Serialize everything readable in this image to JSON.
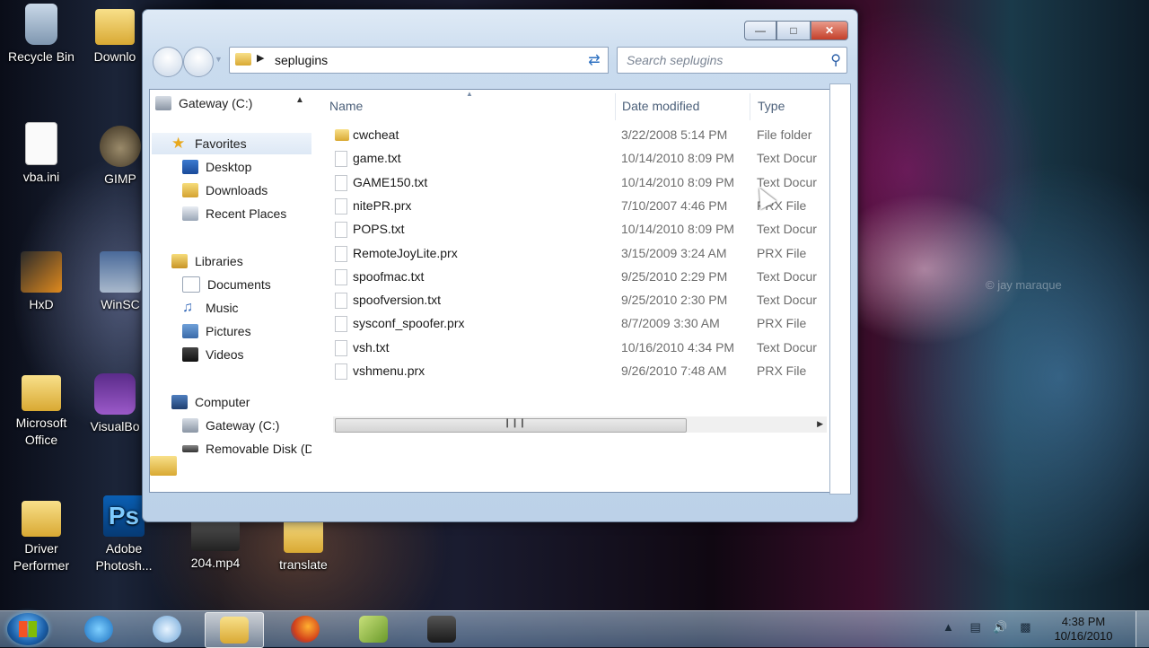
{
  "desktop": {
    "icons": [
      {
        "label": "Recycle Bin",
        "icon": "recycle-bin-icon"
      },
      {
        "label": "Downlo",
        "icon": "folder-icon"
      },
      {
        "label": "vba.ini",
        "icon": "document-icon"
      },
      {
        "label": "GIMP",
        "icon": "gimp-icon"
      },
      {
        "label": "HxD",
        "icon": "hxd-icon"
      },
      {
        "label": "WinSC",
        "icon": "winscp-icon"
      },
      {
        "label": "Microsoft Office",
        "icon": "folder-icon"
      },
      {
        "label": "VisualBo",
        "icon": "visualboy-icon"
      },
      {
        "label": "Driver Performer",
        "icon": "folder-icon"
      },
      {
        "label": "Adobe Photosh...",
        "icon": "photoshop-icon"
      },
      {
        "label": "204.mp4",
        "icon": "video-file-icon"
      },
      {
        "label": "translate",
        "icon": "folder-icon"
      }
    ],
    "watermark": "© jay maraque"
  },
  "window": {
    "address_path": "seplugins",
    "search_placeholder": "Search seplugins",
    "nav": {
      "top_item": "Gateway (C:)",
      "favorites": "Favorites",
      "favorite_items": [
        "Desktop",
        "Downloads",
        "Recent Places"
      ],
      "libraries": "Libraries",
      "library_items": [
        "Documents",
        "Music",
        "Pictures",
        "Videos"
      ],
      "computer": "Computer",
      "computer_items": [
        "Gateway (C:)",
        "Removable Disk (D"
      ]
    },
    "columns": {
      "name": "Name",
      "date": "Date modified",
      "type": "Type"
    },
    "files": [
      {
        "name": "cwcheat",
        "date": "3/22/2008 5:14 PM",
        "type": "File folder",
        "kind": "folder"
      },
      {
        "name": "game.txt",
        "date": "10/14/2010 8:09 PM",
        "type": "Text Docur",
        "kind": "file"
      },
      {
        "name": "GAME150.txt",
        "date": "10/14/2010 8:09 PM",
        "type": "Text Docur",
        "kind": "file"
      },
      {
        "name": "nitePR.prx",
        "date": "7/10/2007 4:46 PM",
        "type": "PRX File",
        "kind": "file"
      },
      {
        "name": "POPS.txt",
        "date": "10/14/2010 8:09 PM",
        "type": "Text Docur",
        "kind": "file"
      },
      {
        "name": "RemoteJoyLite.prx",
        "date": "3/15/2009 3:24 AM",
        "type": "PRX File",
        "kind": "file"
      },
      {
        "name": "spoofmac.txt",
        "date": "9/25/2010 2:29 PM",
        "type": "Text Docur",
        "kind": "file"
      },
      {
        "name": "spoofversion.txt",
        "date": "9/25/2010 2:30 PM",
        "type": "Text Docur",
        "kind": "file"
      },
      {
        "name": "sysconf_spoofer.prx",
        "date": "8/7/2009 3:30 AM",
        "type": "PRX File",
        "kind": "file"
      },
      {
        "name": "vsh.txt",
        "date": "10/16/2010 4:34 PM",
        "type": "Text Docur",
        "kind": "file"
      },
      {
        "name": "vshmenu.prx",
        "date": "9/26/2010 7:48 AM",
        "type": "PRX File",
        "kind": "file"
      }
    ]
  },
  "taskbar": {
    "time": "4:38 PM",
    "date": "10/16/2010"
  }
}
